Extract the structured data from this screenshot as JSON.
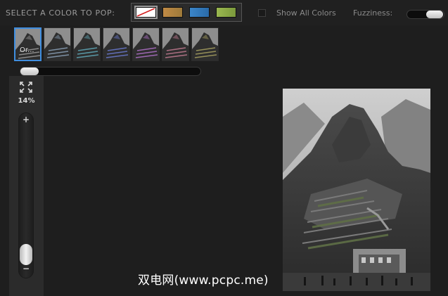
{
  "toolbar": {
    "select_label": "SELECT A COLOR TO POP:",
    "swatches": [
      {
        "name": "none",
        "color": "#ffffff",
        "selected": true
      },
      {
        "name": "orange",
        "color": "#b3843f",
        "selected": false
      },
      {
        "name": "blue",
        "color": "#3378bd",
        "selected": false
      },
      {
        "name": "green",
        "color": "#8eab47",
        "selected": false
      }
    ],
    "show_all_label": "Show All Colors",
    "show_all_checked": false,
    "fuzziness_label": "Fuzziness:",
    "fuzziness_level": 1.0
  },
  "thumbnails": [
    {
      "caption": "Or...",
      "tint": "#9a9a9a",
      "selected": true
    },
    {
      "caption": "",
      "tint": "#8aa0b8",
      "selected": false
    },
    {
      "caption": "",
      "tint": "#5fa8b8",
      "selected": false
    },
    {
      "caption": "",
      "tint": "#6a7ad0",
      "selected": false
    },
    {
      "caption": "",
      "tint": "#b070c8",
      "selected": false
    },
    {
      "caption": "",
      "tint": "#c07a90",
      "selected": false
    },
    {
      "caption": "",
      "tint": "#a8a060",
      "selected": false
    }
  ],
  "thumbnail_scroll_position": 0.0,
  "zoom": {
    "percent_text": "14%",
    "plus": "+",
    "minus": "−",
    "level": 0.14
  },
  "accent_color": "#3f8ee0",
  "watermark": "双电网(www.pcpc.me)"
}
